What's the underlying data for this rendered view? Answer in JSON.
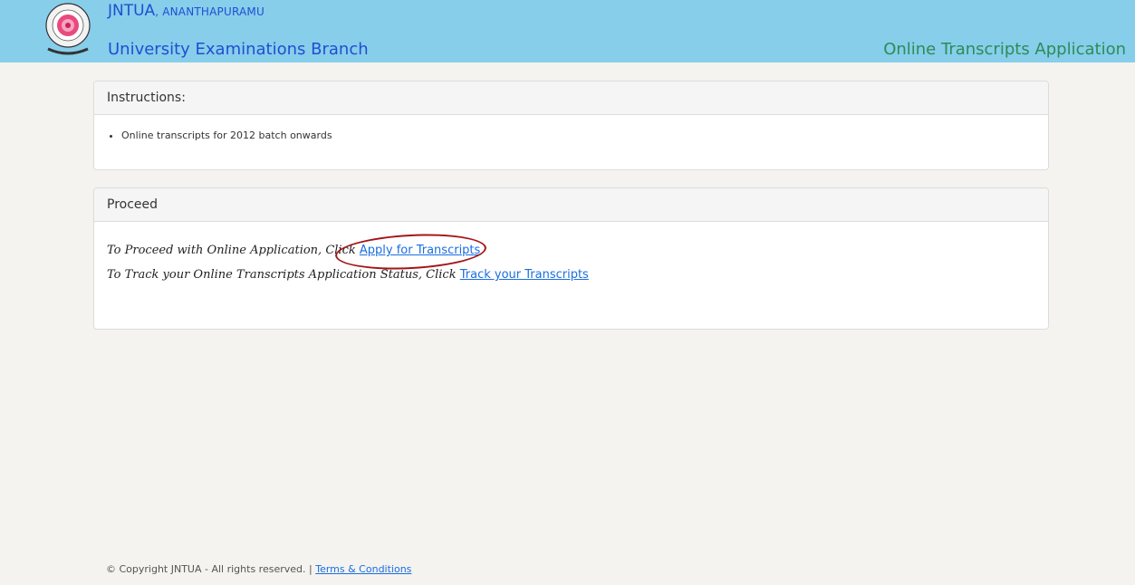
{
  "header": {
    "university_name": "JNTUA",
    "university_city": "ANANTHAPURAMU",
    "branch": "University Examinations Branch",
    "app_title": "Online Transcripts Application"
  },
  "instructions": {
    "heading": "Instructions:",
    "items": [
      "Online transcripts for 2012 batch onwards"
    ]
  },
  "proceed": {
    "heading": "Proceed",
    "apply_text": "To Proceed with Online Application, Click",
    "apply_link": "Apply for Transcripts",
    "track_text": "To Track your Online Transcripts Application Status, Click",
    "track_link": "Track your Transcripts"
  },
  "footer": {
    "copyright": "© Copyright JNTUA - All rights reserved. |",
    "terms_link": "Terms & Conditions"
  },
  "colors": {
    "header_bg": "#87ceeb",
    "header_text": "#1f4fd1",
    "app_title": "#2e8b57",
    "link": "#1a6ee0",
    "highlight": "#a31518"
  }
}
